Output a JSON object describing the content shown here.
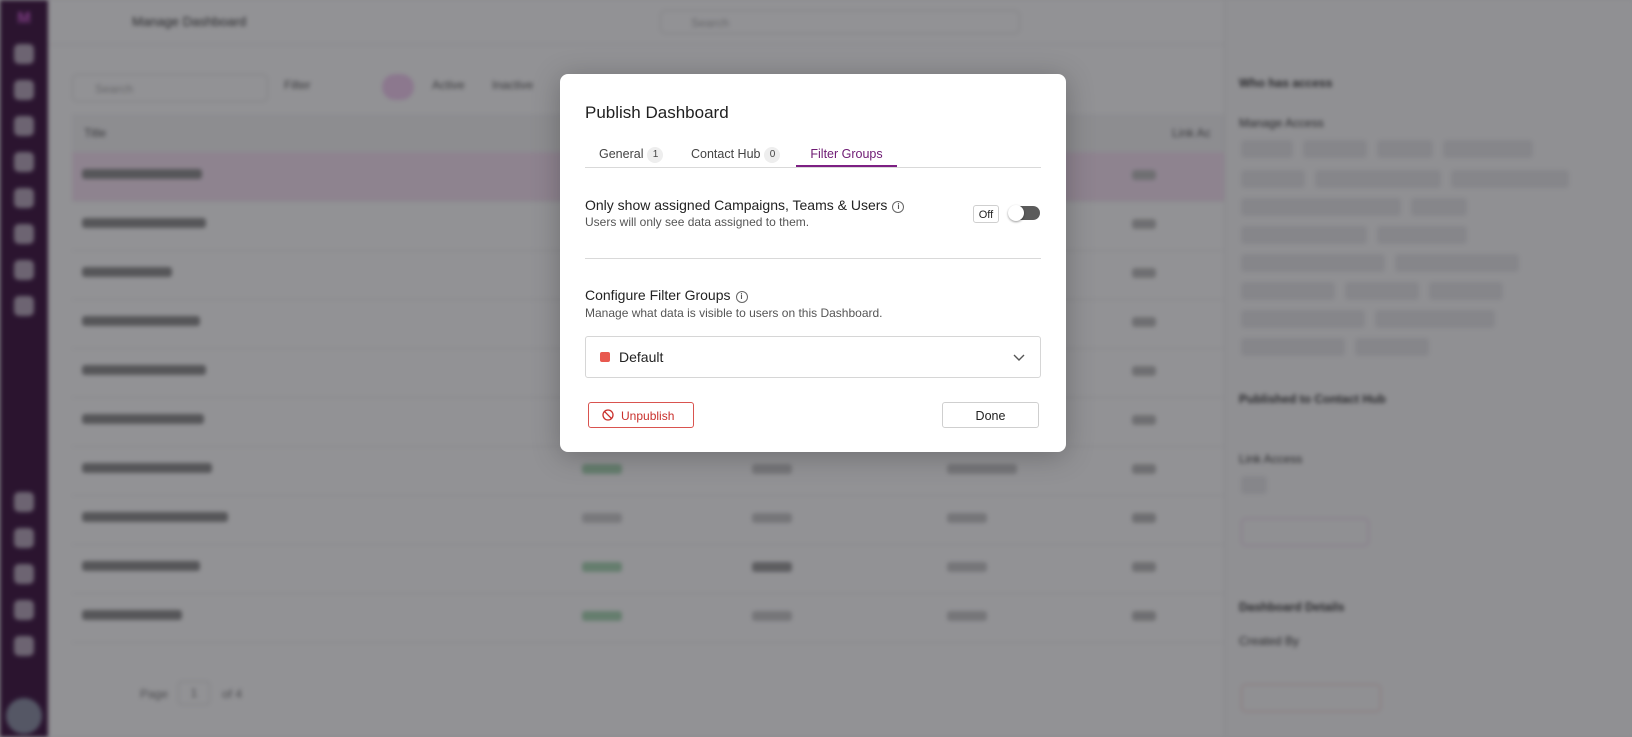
{
  "background": {
    "breadcrumb": "Manage Dashboard",
    "search_placeholder": "Search",
    "table_search_placeholder": "Search",
    "filter_label": "Filter",
    "status_tabs": [
      "All",
      "Active",
      "Inactive"
    ],
    "columns": [
      "Title",
      "Link Ac"
    ],
    "rows": [
      "Automation Wallboard",
      "Automation Omni Stats",
      "Automation test",
      "Automation Call Stats",
      "Automation Login Stats",
      "Automation AMD Stats",
      "Automation SOAM Stats",
      "Automation Monitors Stats",
      "AutoTest20032B_478",
      "BrettaBoard4459"
    ],
    "pager": {
      "page_label": "Page",
      "page_value": "1",
      "of_label": "of 4"
    },
    "side": {
      "who_has_access": "Who has access",
      "manage_access_label": "Manage Access",
      "published_label": "Published to Contact Hub",
      "link_access_label": "Link Access",
      "details_label": "Dashboard Details",
      "created_by_label": "Created By"
    }
  },
  "modal": {
    "title": "Publish Dashboard",
    "tabs": [
      {
        "label": "General",
        "count": "1"
      },
      {
        "label": "Contact Hub",
        "count": "0"
      },
      {
        "label": "Filter Groups",
        "count": ""
      }
    ],
    "active_tab": "Filter Groups",
    "assigned_section": {
      "title": "Only show assigned Campaigns, Teams & Users",
      "description": "Users will only see data assigned to them.",
      "toggle_state": "Off"
    },
    "filter_section": {
      "title": "Configure Filter Groups",
      "description": "Manage what data is visible to users on this Dashboard.",
      "selected_group": "Default",
      "selected_group_color": "#e8594f"
    },
    "unpublish_label": "Unpublish",
    "done_label": "Done"
  }
}
